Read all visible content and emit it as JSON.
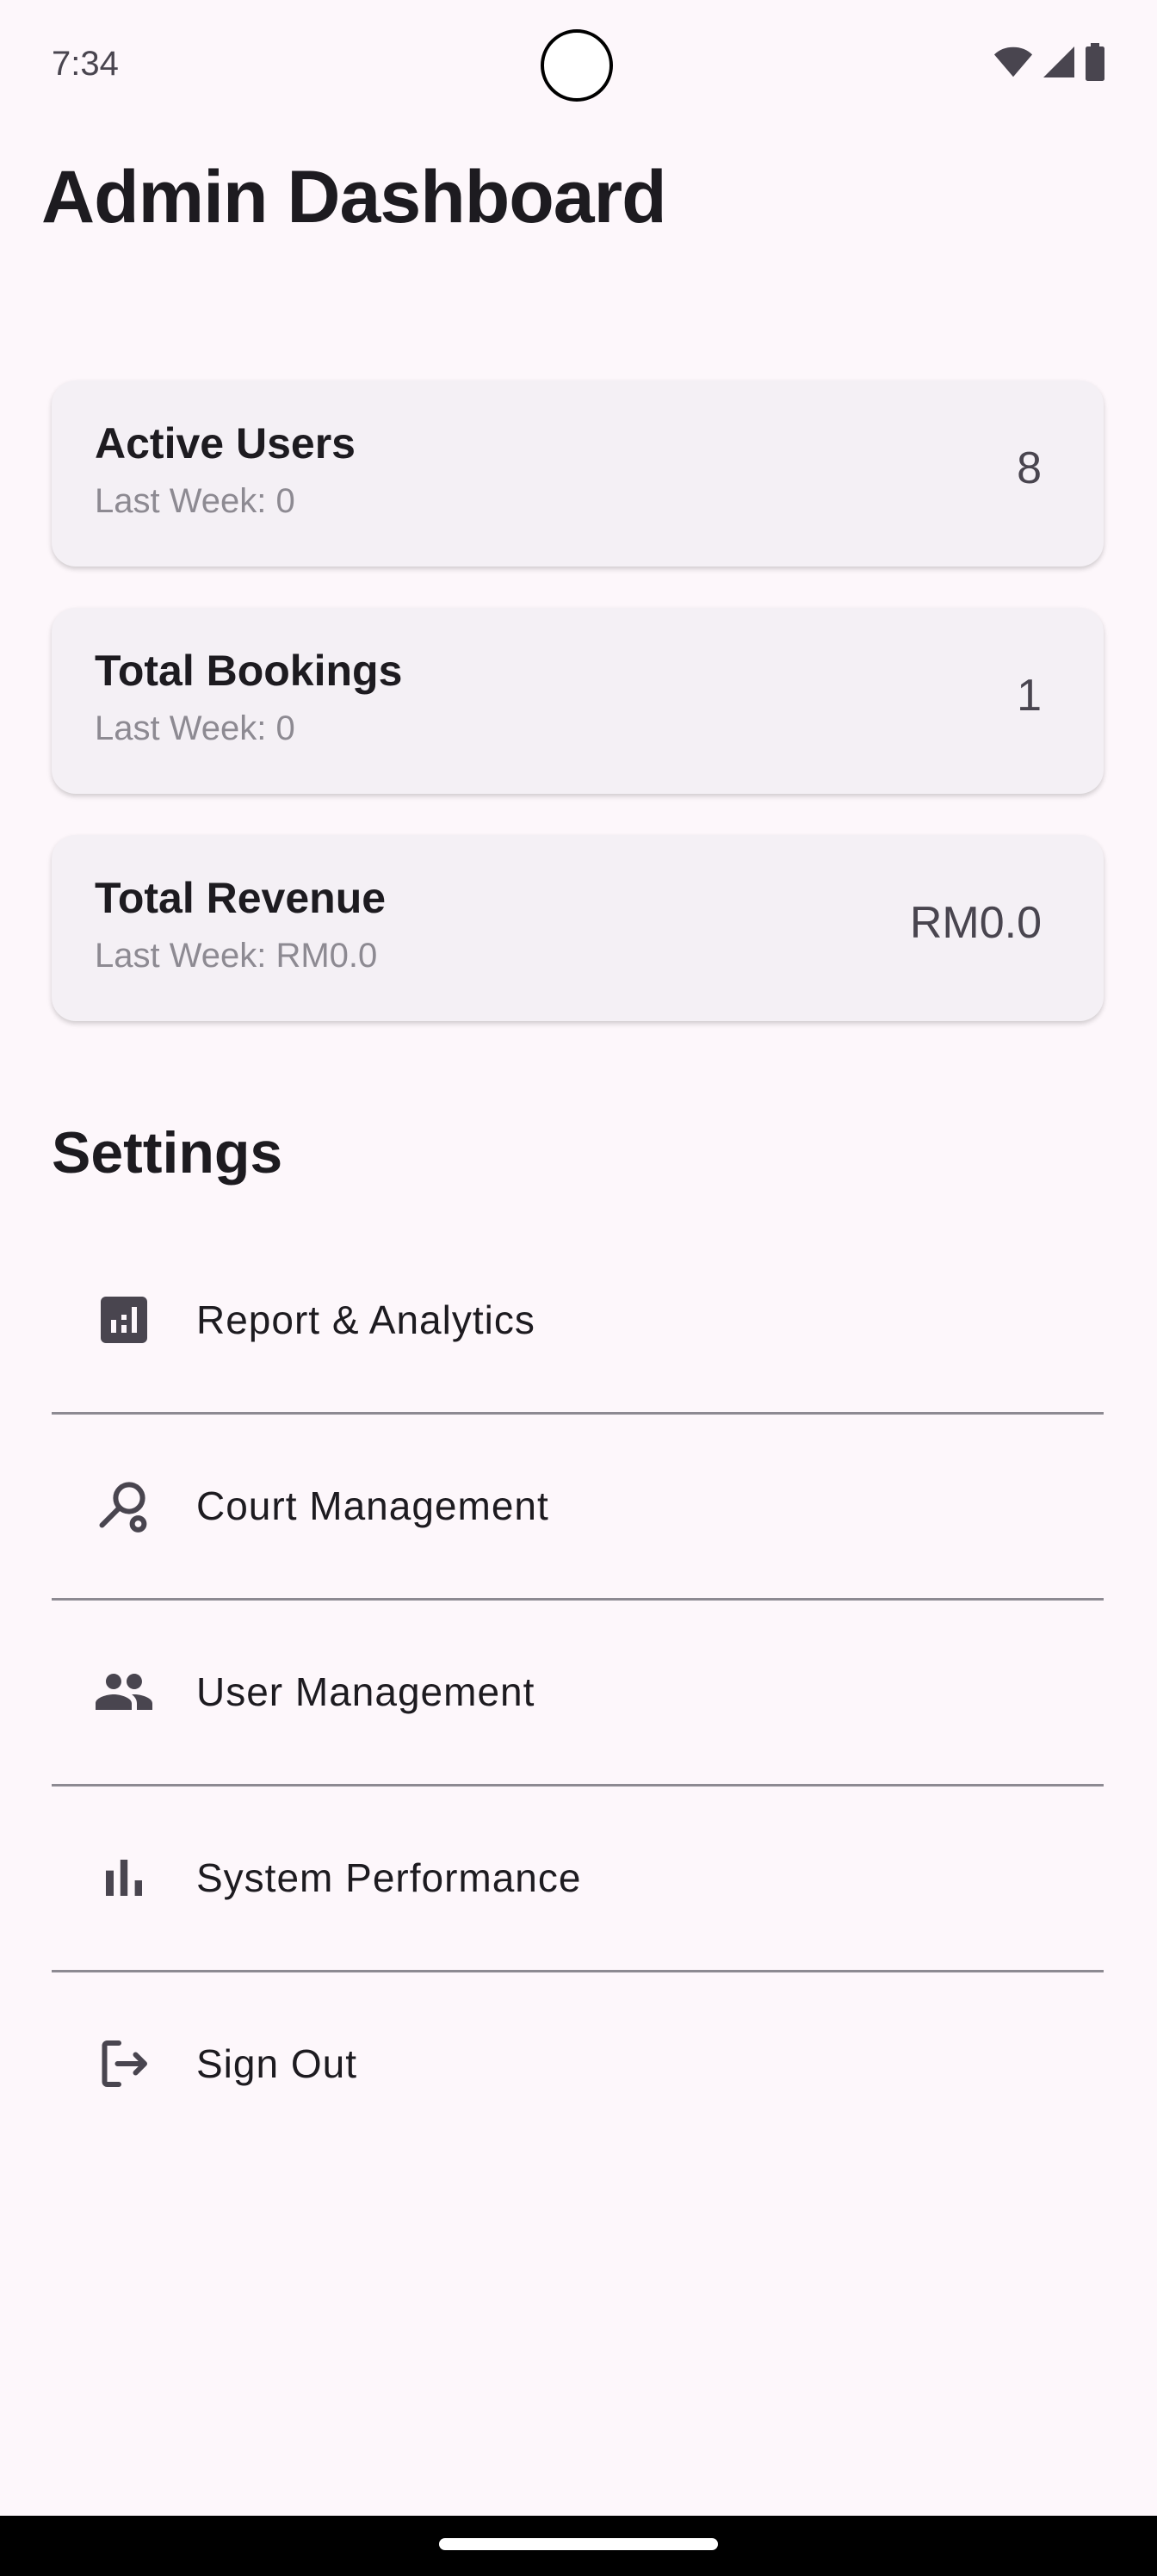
{
  "status_bar": {
    "time": "7:34",
    "icons": [
      "wifi-icon",
      "cell-signal-icon",
      "battery-icon"
    ]
  },
  "header": {
    "title": "Admin Dashboard"
  },
  "stats": [
    {
      "title": "Active Users",
      "subtitle": "Last Week: 0",
      "value": "8"
    },
    {
      "title": "Total Bookings",
      "subtitle": "Last Week: 0",
      "value": "1"
    },
    {
      "title": "Total Revenue",
      "subtitle": "Last Week: RM0.0",
      "value": "RM0.0"
    }
  ],
  "settings": {
    "heading": "Settings",
    "items": [
      {
        "label": "Report & Analytics",
        "icon": "analytics-icon"
      },
      {
        "label": "Court Management",
        "icon": "racket-icon"
      },
      {
        "label": "User Management",
        "icon": "people-icon"
      },
      {
        "label": "System Performance",
        "icon": "bar-chart-icon"
      },
      {
        "label": "Sign Out",
        "icon": "logout-icon"
      }
    ]
  },
  "colors": {
    "background": "#fdf7fb",
    "card": "#f4f0f5",
    "text": "#1d1b20",
    "muted": "#8d8a92",
    "icon": "#49454f"
  }
}
